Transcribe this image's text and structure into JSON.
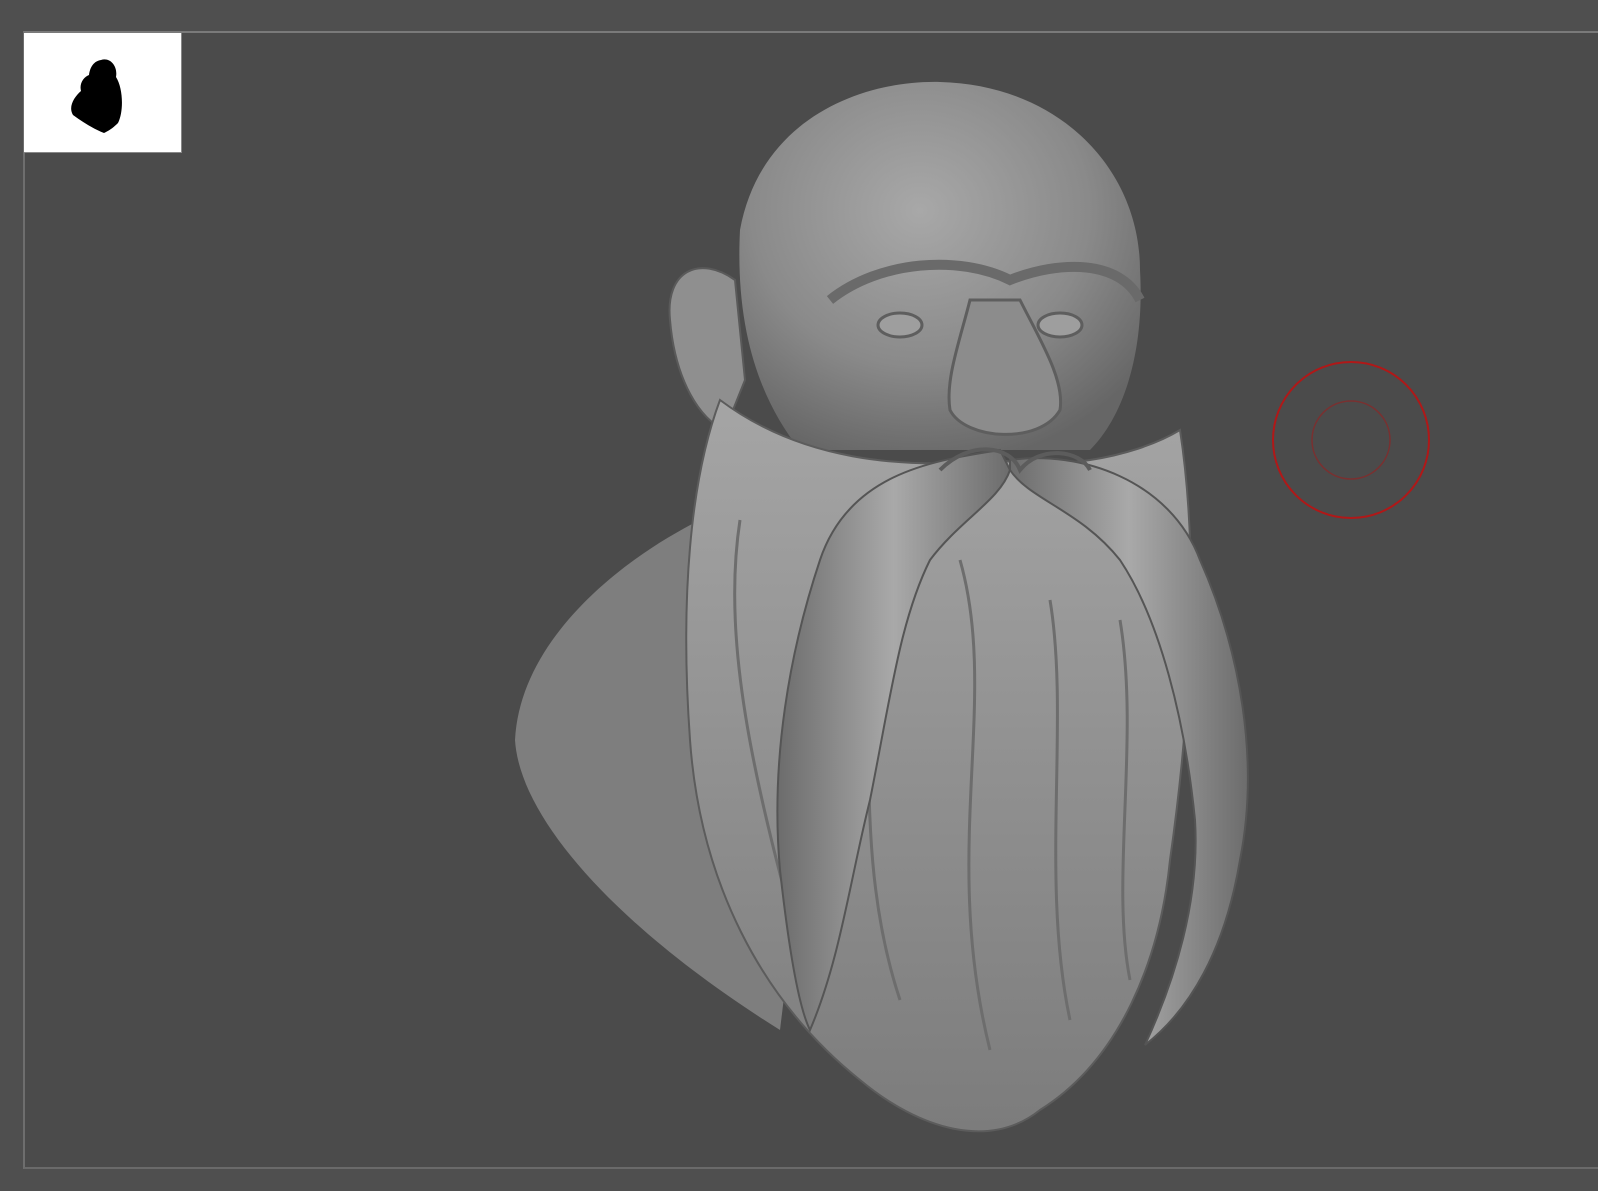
{
  "app": {
    "type": "3d-sculpting-viewport"
  },
  "colors": {
    "background": "#4f4f4f",
    "canvas": "#4b4b4b",
    "canvas_border": "#7a7a7a",
    "navigator_bg": "#ffffff",
    "navigator_silhouette": "#000000",
    "model_base": "#8a8a8a",
    "model_highlight": "#b5b5b5",
    "model_shadow": "#5e5e5e",
    "brush_cursor": "#b01818"
  },
  "icons": {
    "navigator": "model-silhouette-thumbnail",
    "cursor": "brush-cursor-circle"
  }
}
